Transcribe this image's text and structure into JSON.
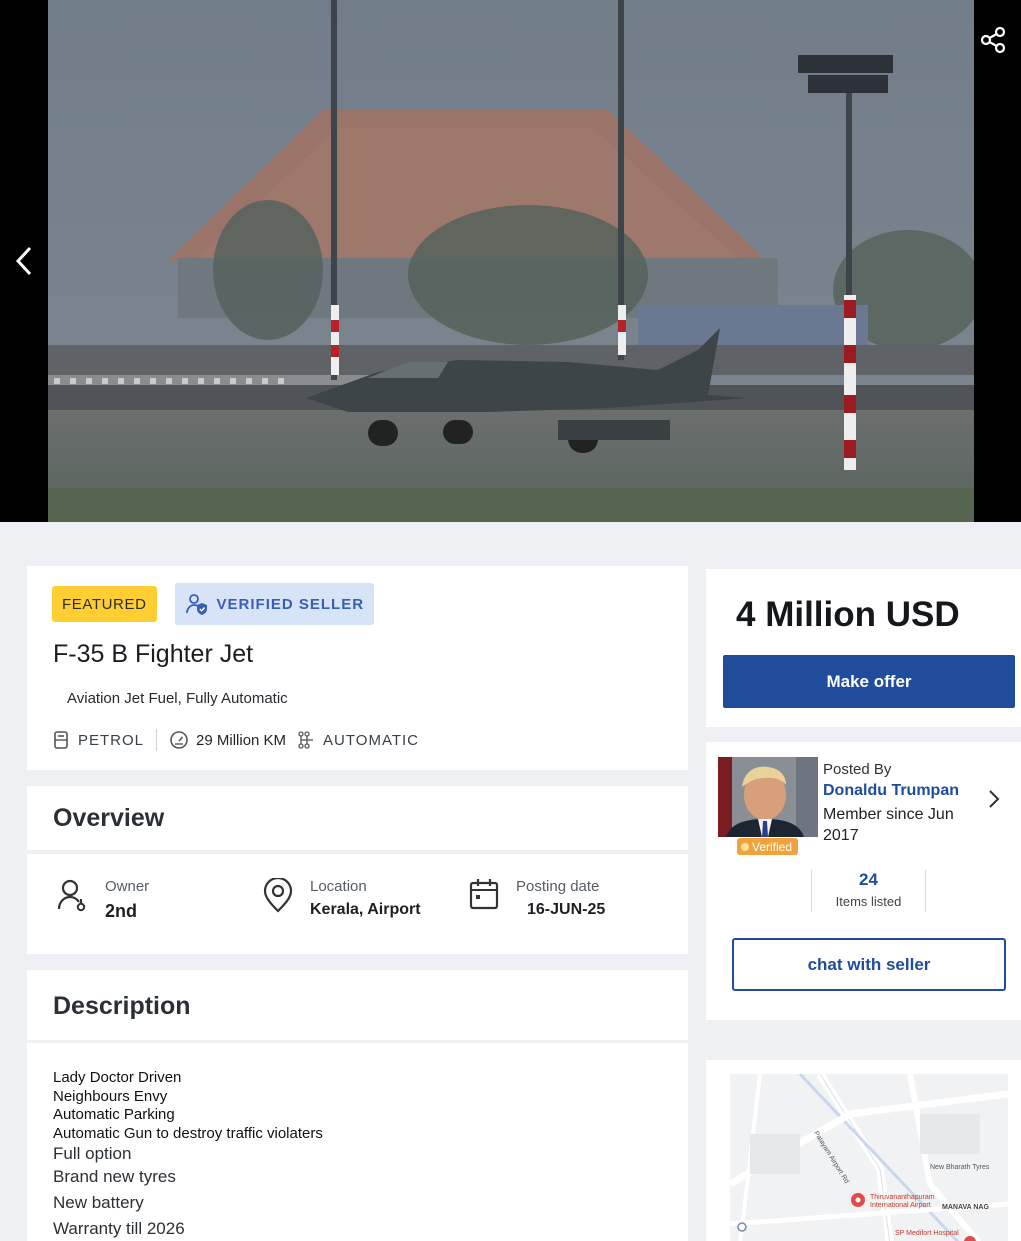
{
  "gallery": {
    "prev_icon": "chevron-left-icon",
    "share_icon": "share-icon"
  },
  "listing": {
    "featured_badge": "FEATURED",
    "verified_badge": "VERIFIED SELLER",
    "title": "F-35 B Fighter Jet",
    "subtitle": "Aviation Jet Fuel, Fully Automatic",
    "specs": {
      "fuel": "PETROL",
      "mileage": "29 Million KM",
      "transmission": "AUTOMATIC"
    }
  },
  "overview": {
    "heading": "Overview",
    "owner_label": "Owner",
    "owner_value": "2nd",
    "location_label": "Location",
    "location_value": "Kerala, Airport",
    "posting_label": "Posting date",
    "posting_value": "16-JUN-25"
  },
  "description": {
    "heading": "Description",
    "lines": [
      "Lady Doctor Driven",
      "Neighbours Envy",
      "Automatic Parking",
      "Automatic Gun to destroy traffic violaters",
      "Full option",
      "Brand new tyres",
      "New battery",
      "Warranty till 2026"
    ]
  },
  "price": {
    "amount": "4 Million USD",
    "offer_button": "Make offer"
  },
  "seller": {
    "verified_chip": "Verified",
    "posted_by_label": "Posted By",
    "name": "Donaldu Trumpan",
    "member_since": "Member since Jun 2017",
    "items_count": "24",
    "items_label": "Items listed",
    "chat_button": "chat with seller"
  },
  "map": {
    "labels": {
      "road": "Palayam Airport Rd",
      "airport": "Thiruvananthapuram International Airport",
      "shop": "New Bharath Tyres",
      "area": "MANAVA NAG",
      "hospital": "SP Medifort Hospital"
    }
  },
  "colors": {
    "brand_blue": "#1f4d9c",
    "featured_yellow": "#ffce32",
    "verified_bg": "#d7e3f7",
    "verified_orange": "#f0a33d"
  }
}
